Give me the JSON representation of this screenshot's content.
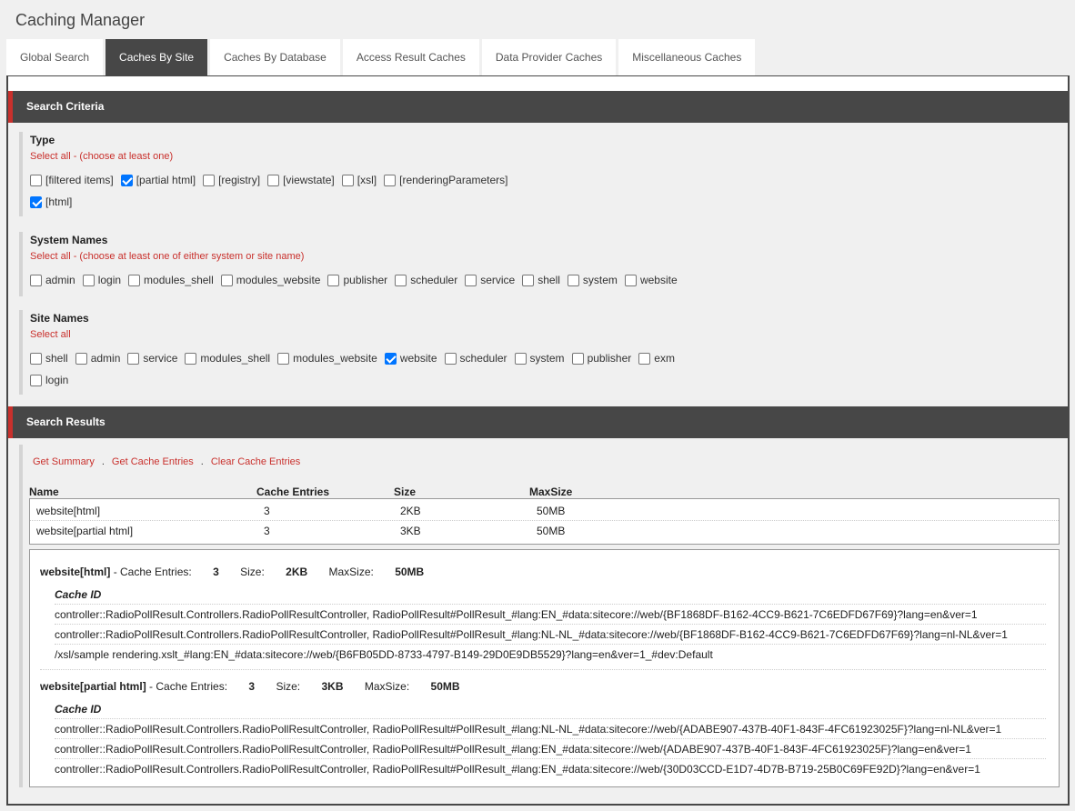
{
  "app_title": "Caching Manager",
  "tabs": [
    {
      "label": "Global Search",
      "active": false
    },
    {
      "label": "Caches By Site",
      "active": true
    },
    {
      "label": "Caches By Database",
      "active": false
    },
    {
      "label": "Access Result Caches",
      "active": false
    },
    {
      "label": "Data Provider Caches",
      "active": false
    },
    {
      "label": "Miscellaneous Caches",
      "active": false
    }
  ],
  "search_criteria": {
    "title": "Search Criteria",
    "type": {
      "title": "Type",
      "select_all": "Select all - (choose at least one)",
      "options": [
        {
          "label": "[filtered items]",
          "checked": false
        },
        {
          "label": "[partial html]",
          "checked": true
        },
        {
          "label": "[registry]",
          "checked": false
        },
        {
          "label": "[viewstate]",
          "checked": false
        },
        {
          "label": "[xsl]",
          "checked": false
        },
        {
          "label": "[renderingParameters]",
          "checked": false
        },
        {
          "label": "[html]",
          "checked": true
        }
      ]
    },
    "system_names": {
      "title": "System Names",
      "select_all": "Select all - (choose at least one of either system or site name)",
      "options": [
        {
          "label": "admin",
          "checked": false
        },
        {
          "label": "login",
          "checked": false
        },
        {
          "label": "modules_shell",
          "checked": false
        },
        {
          "label": "modules_website",
          "checked": false
        },
        {
          "label": "publisher",
          "checked": false
        },
        {
          "label": "scheduler",
          "checked": false
        },
        {
          "label": "service",
          "checked": false
        },
        {
          "label": "shell",
          "checked": false
        },
        {
          "label": "system",
          "checked": false
        },
        {
          "label": "website",
          "checked": false
        }
      ]
    },
    "site_names": {
      "title": "Site Names",
      "select_all": "Select all",
      "options": [
        {
          "label": "shell",
          "checked": false
        },
        {
          "label": "admin",
          "checked": false
        },
        {
          "label": "service",
          "checked": false
        },
        {
          "label": "modules_shell",
          "checked": false
        },
        {
          "label": "modules_website",
          "checked": false
        },
        {
          "label": "website",
          "checked": true
        },
        {
          "label": "scheduler",
          "checked": false
        },
        {
          "label": "system",
          "checked": false
        },
        {
          "label": "publisher",
          "checked": false
        },
        {
          "label": "exm",
          "checked": false
        },
        {
          "label": "login",
          "checked": false
        }
      ]
    }
  },
  "search_results": {
    "title": "Search Results",
    "links": {
      "get_summary": "Get Summary",
      "separator": ".",
      "get_cache_entries": "Get Cache Entries",
      "clear_cache_entries": "Clear Cache Entries"
    },
    "columns": {
      "name": "Name",
      "entries": "Cache Entries",
      "size": "Size",
      "maxsize": "MaxSize"
    },
    "rows": [
      {
        "name": "website[html]",
        "entries": "3",
        "size": "2KB",
        "maxsize": "50MB"
      },
      {
        "name": "website[partial html]",
        "entries": "3",
        "size": "3KB",
        "maxsize": "50MB"
      }
    ],
    "details": [
      {
        "name": "website[html]",
        "entries_label": "- Cache Entries:",
        "entries": "3",
        "size_label": "Size:",
        "size": "2KB",
        "maxsize_label": "MaxSize:",
        "maxsize": "50MB",
        "cache_id_title": "Cache ID",
        "ids": [
          "controller::RadioPollResult.Controllers.RadioPollResultController, RadioPollResult#PollResult_#lang:EN_#data:sitecore://web/{BF1868DF-B162-4CC9-B621-7C6EDFD67F69}?lang=en&ver=1",
          "controller::RadioPollResult.Controllers.RadioPollResultController, RadioPollResult#PollResult_#lang:NL-NL_#data:sitecore://web/{BF1868DF-B162-4CC9-B621-7C6EDFD67F69}?lang=nl-NL&ver=1",
          "/xsl/sample rendering.xslt_#lang:EN_#data:sitecore://web/{B6FB05DD-8733-4797-B149-29D0E9DB5529}?lang=en&ver=1_#dev:Default"
        ]
      },
      {
        "name": "website[partial html]",
        "entries_label": "- Cache Entries:",
        "entries": "3",
        "size_label": "Size:",
        "size": "3KB",
        "maxsize_label": "MaxSize:",
        "maxsize": "50MB",
        "cache_id_title": "Cache ID",
        "ids": [
          "controller::RadioPollResult.Controllers.RadioPollResultController, RadioPollResult#PollResult_#lang:NL-NL_#data:sitecore://web/{ADABE907-437B-40F1-843F-4FC61923025F}?lang=nl-NL&ver=1",
          "controller::RadioPollResult.Controllers.RadioPollResultController, RadioPollResult#PollResult_#lang:EN_#data:sitecore://web/{ADABE907-437B-40F1-843F-4FC61923025F}?lang=en&ver=1",
          "controller::RadioPollResult.Controllers.RadioPollResultController, RadioPollResult#PollResult_#lang:EN_#data:sitecore://web/{30D03CCD-E1D7-4D7B-B719-25B0C69FE92D}?lang=en&ver=1"
        ]
      }
    ]
  }
}
